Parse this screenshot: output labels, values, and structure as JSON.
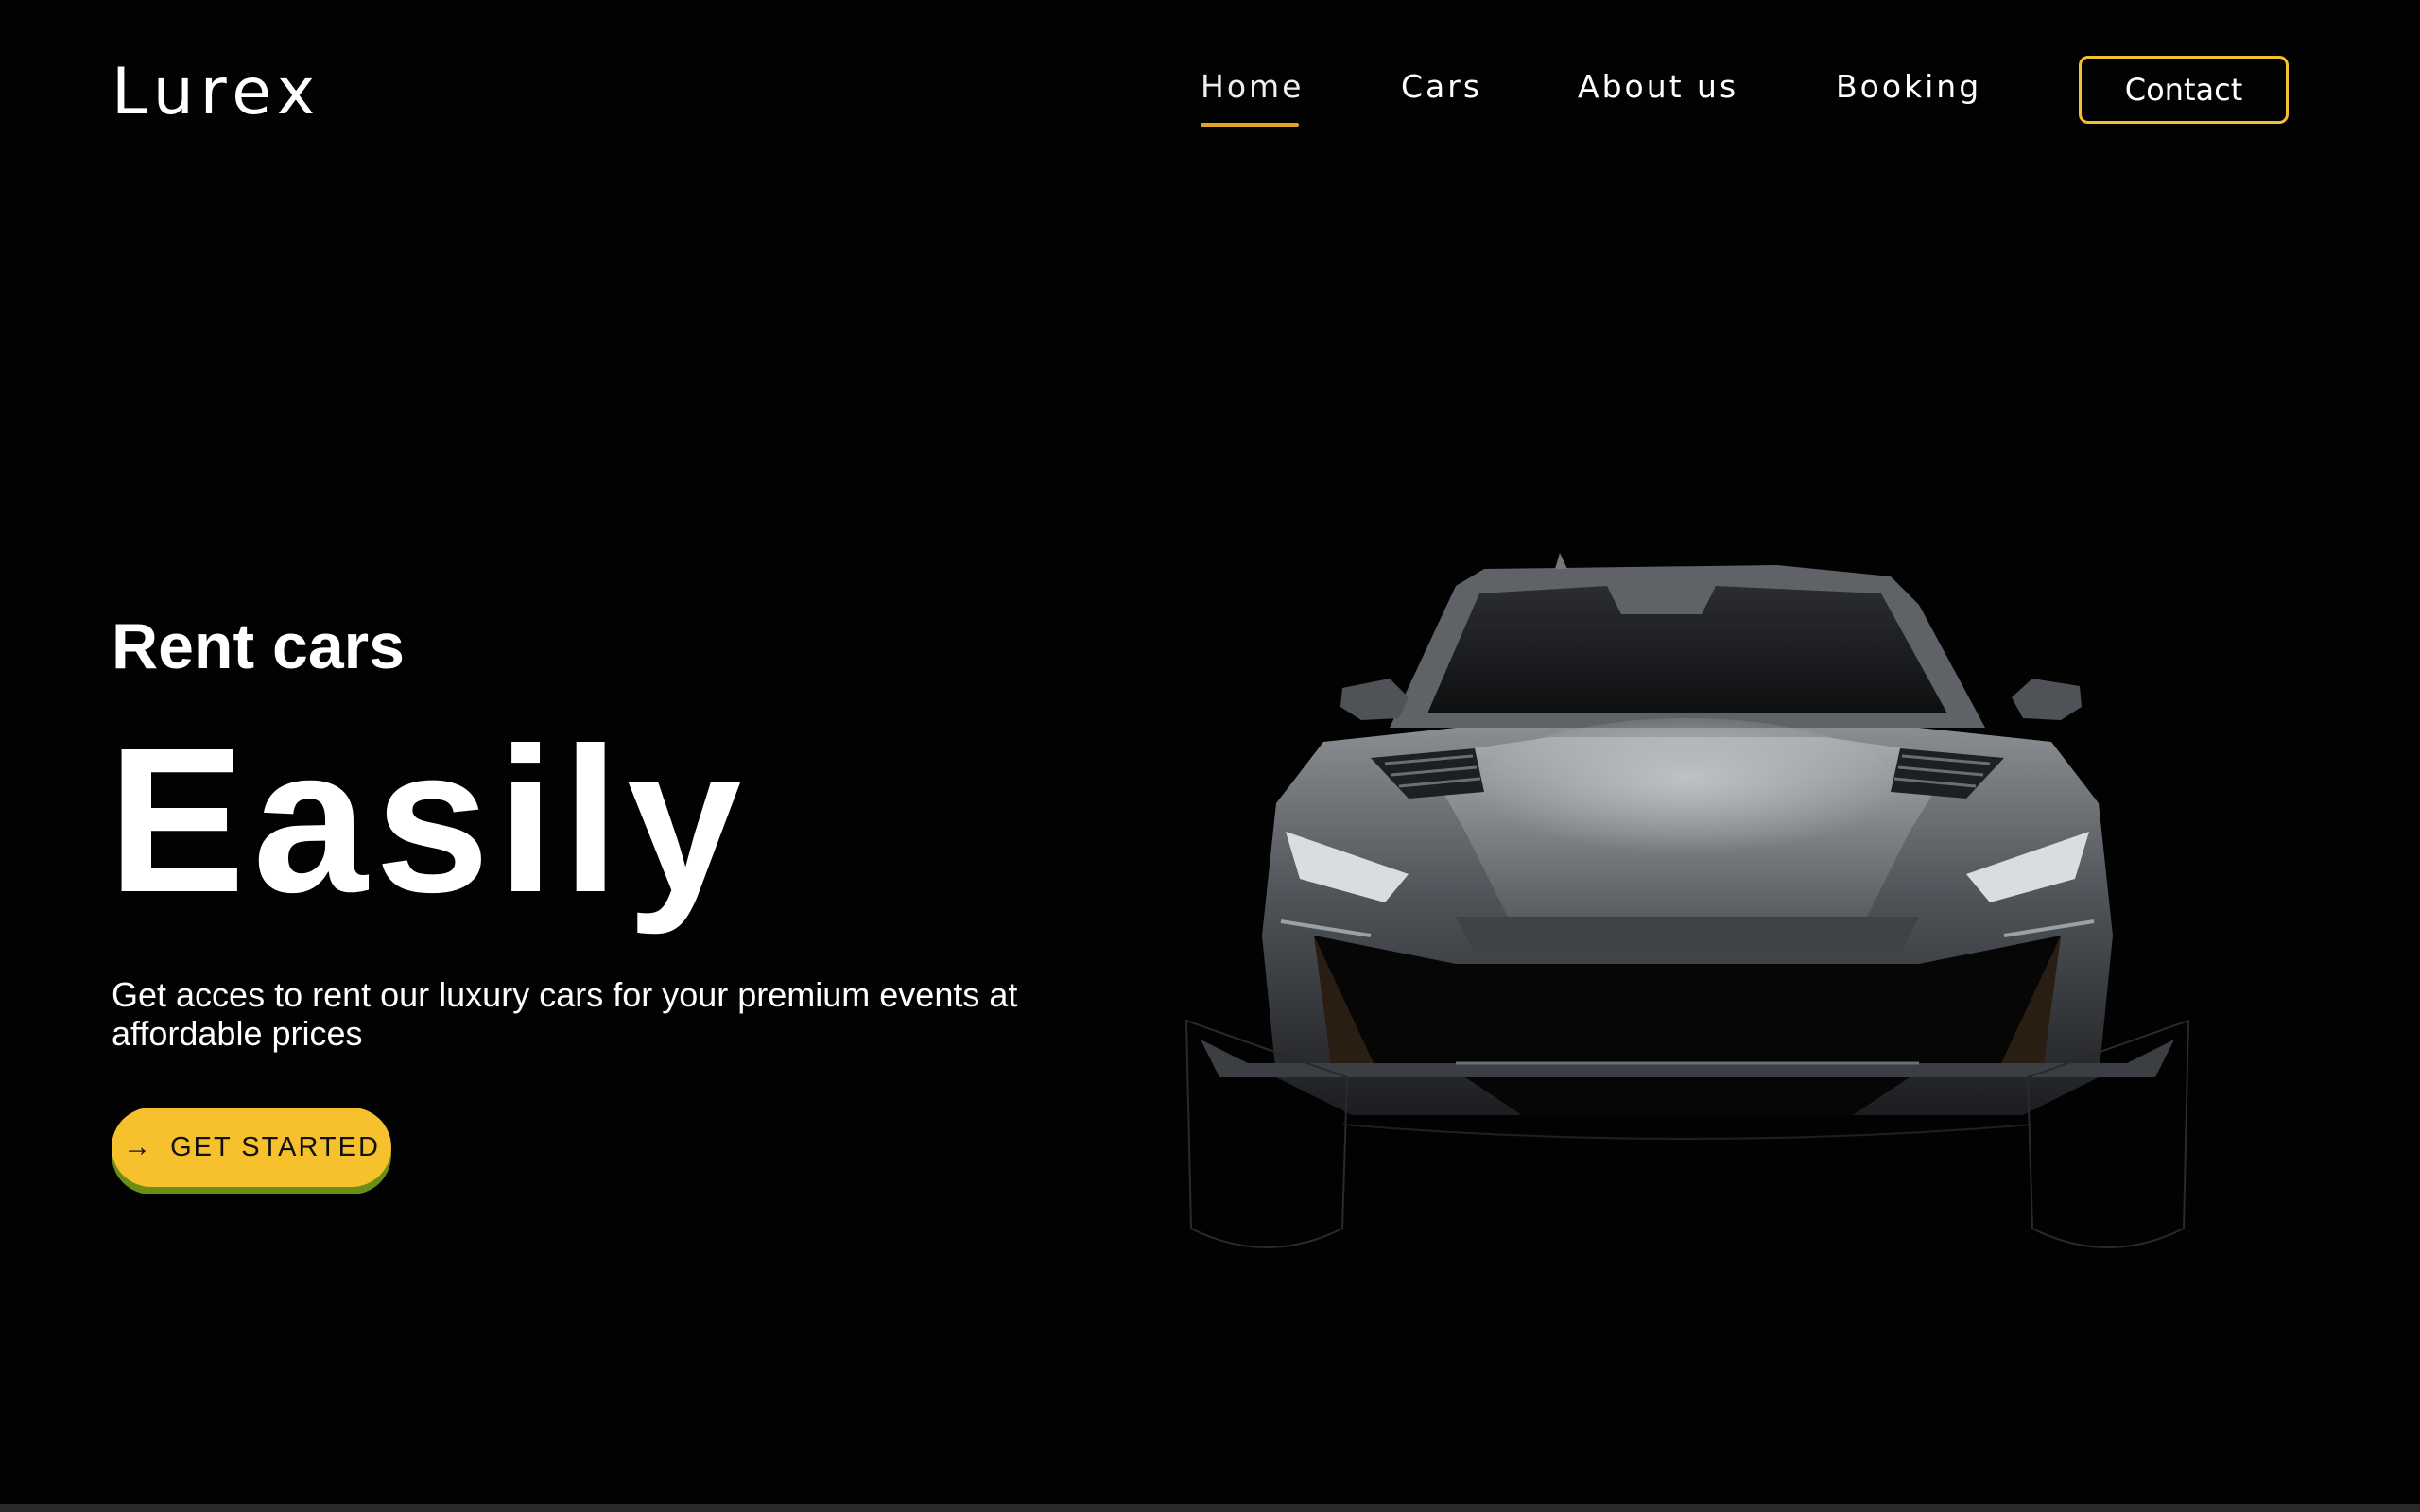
{
  "header": {
    "brand": "Lurex",
    "nav": [
      {
        "label": "Home",
        "active": true
      },
      {
        "label": "Cars",
        "active": false
      },
      {
        "label": "About us",
        "active": false
      },
      {
        "label": "Booking",
        "active": false
      }
    ],
    "contact_label": "Contact"
  },
  "hero": {
    "subtitle": "Rent cars",
    "title": "Easily",
    "description": "Get acces to rent our luxury cars for your premium events at affordable prices",
    "cta_label": "GET STARTED",
    "cta_icon": "arrow-right-icon"
  },
  "colors": {
    "background": "#020202",
    "accent": "#f6c12c",
    "nav_underline": "#e0a526",
    "text": "#ffffff"
  }
}
